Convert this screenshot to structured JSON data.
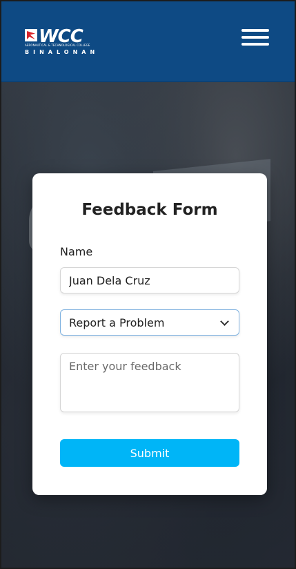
{
  "header": {
    "logo_text": "WCC",
    "logo_subtitle": "AERONAUTICAL & TECHNOLOGICAL COLLEGE",
    "logo_location": "BINALONAN",
    "menu_icon": "hamburger-menu-icon"
  },
  "form": {
    "title": "Feedback Form",
    "name_label": "Name",
    "name_value": "Juan Dela Cruz",
    "type_selected": "Report a Problem",
    "feedback_placeholder": "Enter your feedback",
    "submit_label": "Submit"
  },
  "colors": {
    "header_bg": "#0e4a84",
    "submit_bg": "#00b5f7"
  }
}
